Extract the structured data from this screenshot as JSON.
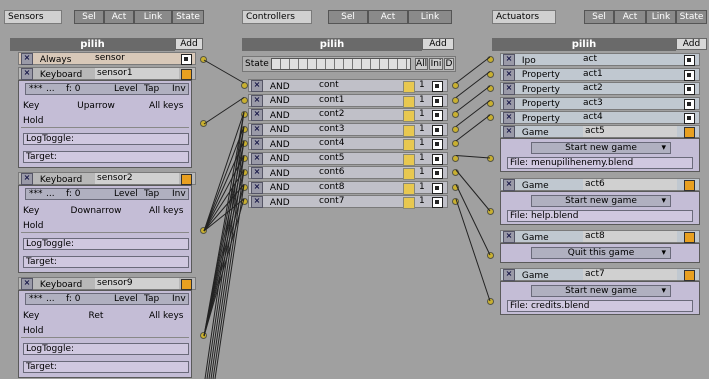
{
  "sensors": {
    "header_label": "Sensors",
    "tabs": [
      "Sel",
      "Act",
      "Link",
      "State"
    ],
    "title": "pilih",
    "add": "Add",
    "always_row": {
      "type": "Always",
      "name": "sensor"
    },
    "keyboard": [
      {
        "type": "Keyboard",
        "name": "sensor1",
        "tap_level": [
          "***",
          "...",
          "f: 0",
          "Level",
          "Tap",
          "Inv"
        ],
        "key_label": "Key",
        "key_value": "Uparrow",
        "allkeys": "All keys",
        "hold": "Hold",
        "logtoggle": "LogToggle:",
        "target": "Target:"
      },
      {
        "type": "Keyboard",
        "name": "sensor2",
        "tap_level": [
          "***",
          "...",
          "f: 0",
          "Level",
          "Tap",
          "Inv"
        ],
        "key_label": "Key",
        "key_value": "Downarrow",
        "allkeys": "All keys",
        "hold": "Hold",
        "logtoggle": "LogToggle:",
        "target": "Target:"
      },
      {
        "type": "Keyboard",
        "name": "sensor9",
        "tap_level": [
          "***",
          "...",
          "f: 0",
          "Level",
          "Tap",
          "Inv"
        ],
        "key_label": "Key",
        "key_value": "Ret",
        "allkeys": "All keys",
        "hold": "Hold",
        "logtoggle": "LogToggle:",
        "target": "Target:"
      }
    ]
  },
  "controllers": {
    "header_label": "Controllers",
    "tabs": [
      "Sel",
      "Act",
      "Link"
    ],
    "title": "pilih",
    "add": "Add",
    "state_label": "State",
    "all_ini_d": [
      "All",
      "Ini",
      "D"
    ],
    "rows": [
      {
        "type": "AND",
        "name": "cont",
        "prio": "1"
      },
      {
        "type": "AND",
        "name": "cont1",
        "prio": "1"
      },
      {
        "type": "AND",
        "name": "cont2",
        "prio": "1"
      },
      {
        "type": "AND",
        "name": "cont3",
        "prio": "1"
      },
      {
        "type": "AND",
        "name": "cont4",
        "prio": "1"
      },
      {
        "type": "AND",
        "name": "cont5",
        "prio": "1"
      },
      {
        "type": "AND",
        "name": "cont6",
        "prio": "1"
      },
      {
        "type": "AND",
        "name": "cont8",
        "prio": "1"
      },
      {
        "type": "AND",
        "name": "cont7",
        "prio": "1"
      }
    ]
  },
  "actuators": {
    "header_label": "Actuators",
    "tabs": [
      "Sel",
      "Act",
      "Link",
      "State"
    ],
    "title": "pilih",
    "add": "Add",
    "simple_rows": [
      {
        "type": "Ipo",
        "name": "act"
      },
      {
        "type": "Property",
        "name": "act1"
      },
      {
        "type": "Property",
        "name": "act2"
      },
      {
        "type": "Property",
        "name": "act3"
      },
      {
        "type": "Property",
        "name": "act4"
      }
    ],
    "game_blocks": [
      {
        "type": "Game",
        "name": "act5",
        "mode": "Start new game",
        "file": "File: menupilihenemy.blend"
      },
      {
        "type": "Game",
        "name": "act6",
        "mode": "Start new game",
        "file": "File: help.blend"
      },
      {
        "type": "Game",
        "name": "act8",
        "mode": "Quit this game",
        "file": ""
      },
      {
        "type": "Game",
        "name": "act7",
        "mode": "Start new game",
        "file": "File: credits.blend"
      }
    ]
  }
}
